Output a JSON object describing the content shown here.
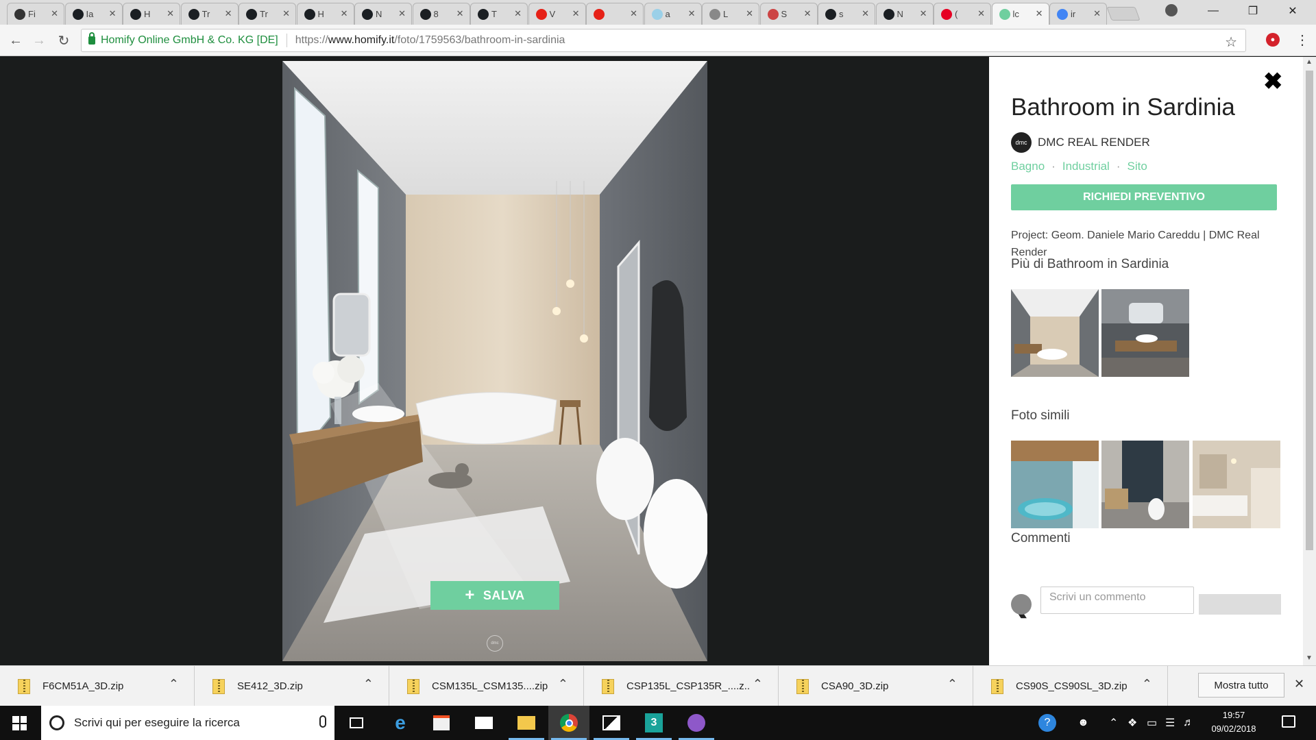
{
  "browser": {
    "tabs": [
      {
        "label": "Fi",
        "favicon": "arrow-icon",
        "color": "#333333"
      },
      {
        "label": "Ia",
        "favicon": "github-icon",
        "color": "#1b1f23"
      },
      {
        "label": "H",
        "favicon": "github-icon",
        "color": "#1b1f23"
      },
      {
        "label": "Tr",
        "favicon": "github-icon",
        "color": "#1b1f23"
      },
      {
        "label": "Tr",
        "favicon": "github-icon",
        "color": "#1b1f23"
      },
      {
        "label": "H",
        "favicon": "github-icon",
        "color": "#1b1f23"
      },
      {
        "label": "N",
        "favicon": "github-icon",
        "color": "#1b1f23"
      },
      {
        "label": "8",
        "favicon": "github-icon",
        "color": "#1b1f23"
      },
      {
        "label": "T",
        "favicon": "github-icon",
        "color": "#1b1f23"
      },
      {
        "label": "V",
        "favicon": "youtube-icon",
        "color": "#e62117"
      },
      {
        "label": "",
        "favicon": "youtube-icon",
        "color": "#e62117"
      },
      {
        "label": "a",
        "favicon": "page-icon",
        "color": "#9bd0e8"
      },
      {
        "label": "L",
        "favicon": "document-icon",
        "color": "#888888"
      },
      {
        "label": "S",
        "favicon": "image-icon",
        "color": "#c44"
      },
      {
        "label": "s",
        "favicon": "github-icon",
        "color": "#1b1f23"
      },
      {
        "label": "N",
        "favicon": "github-icon",
        "color": "#1b1f23"
      },
      {
        "label": "(",
        "favicon": "pinterest-icon",
        "color": "#e60023"
      },
      {
        "label": "lc",
        "favicon": "homify-icon",
        "color": "#6fcf9f"
      },
      {
        "label": "ir",
        "favicon": "google-icon",
        "color": "#4285f4"
      }
    ],
    "active_tab_index": 17,
    "site_identity": "Homify Online GmbH & Co. KG [DE]",
    "url_prefix": "https://",
    "url_host": "www.homify.it",
    "url_path": "/foto/1759563/bathroom-in-sardinia"
  },
  "photo": {
    "save_label": "SALVA",
    "watermark": "dmc"
  },
  "panel": {
    "title": "Bathroom in Sardinia",
    "author": "DMC REAL RENDER",
    "author_avatar": "dmc",
    "tags": [
      "Bagno",
      "Industrial",
      "Sito"
    ],
    "quote_button": "RICHIEDI PREVENTIVO",
    "description": "Project: Geom. Daniele Mario Careddu | DMC Real Render",
    "more_title": "Più di Bathroom in Sardinia",
    "similar_title": "Foto simili",
    "comments_title": "Commenti",
    "comment_placeholder": "Scrivi un commento"
  },
  "downloads": {
    "items": [
      "F6CM51A_3D.zip",
      "SE412_3D.zip",
      "CSM135L_CSM135....zip",
      "CSP135L_CSP135R_....z...",
      "CSA90_3D.zip",
      "CS90S_CS90SL_3D.zip"
    ],
    "show_all": "Mostra tutto"
  },
  "taskbar": {
    "search_placeholder": "Scrivi qui per eseguire la ricerca",
    "time": "19:57",
    "date": "09/02/2018"
  },
  "colors": {
    "accent": "#6fcf9f",
    "viewer_bg": "#1a1c1c",
    "secure": "#1e8e3e"
  }
}
